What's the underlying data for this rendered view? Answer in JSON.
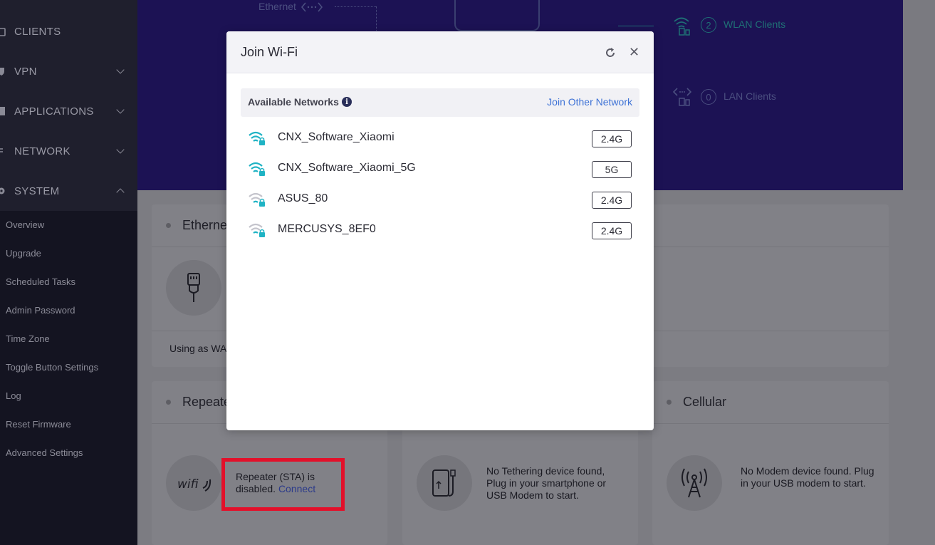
{
  "sidebar": {
    "main_items": [
      {
        "label": "CLIENTS",
        "icon": "clients-icon"
      },
      {
        "label": "VPN",
        "icon": "shield-icon"
      },
      {
        "label": "APPLICATIONS",
        "icon": "applications-icon"
      },
      {
        "label": "NETWORK",
        "icon": "network-icon"
      },
      {
        "label": "SYSTEM",
        "icon": "gear-icon"
      }
    ],
    "sub_items": [
      "Overview",
      "Upgrade",
      "Scheduled Tasks",
      "Admin Password",
      "Time Zone",
      "Toggle Button Settings",
      "Log",
      "Reset Firmware",
      "Advanced Settings"
    ]
  },
  "hero": {
    "ethernet_label": "Ethernet",
    "wlan_count": "2",
    "wlan_label": "WLAN Clients",
    "lan_count": "0",
    "lan_label": "LAN Clients"
  },
  "cards": {
    "ethernet_title": "Ethernet",
    "ethernet_footer": "Using as WAN",
    "repeater_title": "Repeater",
    "repeater_text": "Repeater (STA) is disabled.",
    "repeater_link": "Connect",
    "tethering_text": "No Tethering device found, Plug in your smartphone or USB Modem to start.",
    "cellular_title": "Cellular",
    "cellular_text": "No Modem device found. Plug in your USB modem to start."
  },
  "modal": {
    "title": "Join Wi-Fi",
    "section_title": "Available Networks",
    "join_other": "Join Other Network",
    "networks": [
      {
        "ssid": "CNX_Software_Xiaomi",
        "band": "2.4G",
        "signal": "strong"
      },
      {
        "ssid": "CNX_Software_Xiaomi_5G",
        "band": "5G",
        "signal": "strong"
      },
      {
        "ssid": "ASUS_80",
        "band": "2.4G",
        "signal": "weak"
      },
      {
        "ssid": "MERCUSYS_8EF0",
        "band": "2.4G",
        "signal": "weak"
      }
    ]
  },
  "colors": {
    "accent_teal": "#1fb3c4",
    "weak_gray": "#b5b5bd",
    "link_blue": "#3f73d6",
    "highlight_red": "#e3102a"
  }
}
